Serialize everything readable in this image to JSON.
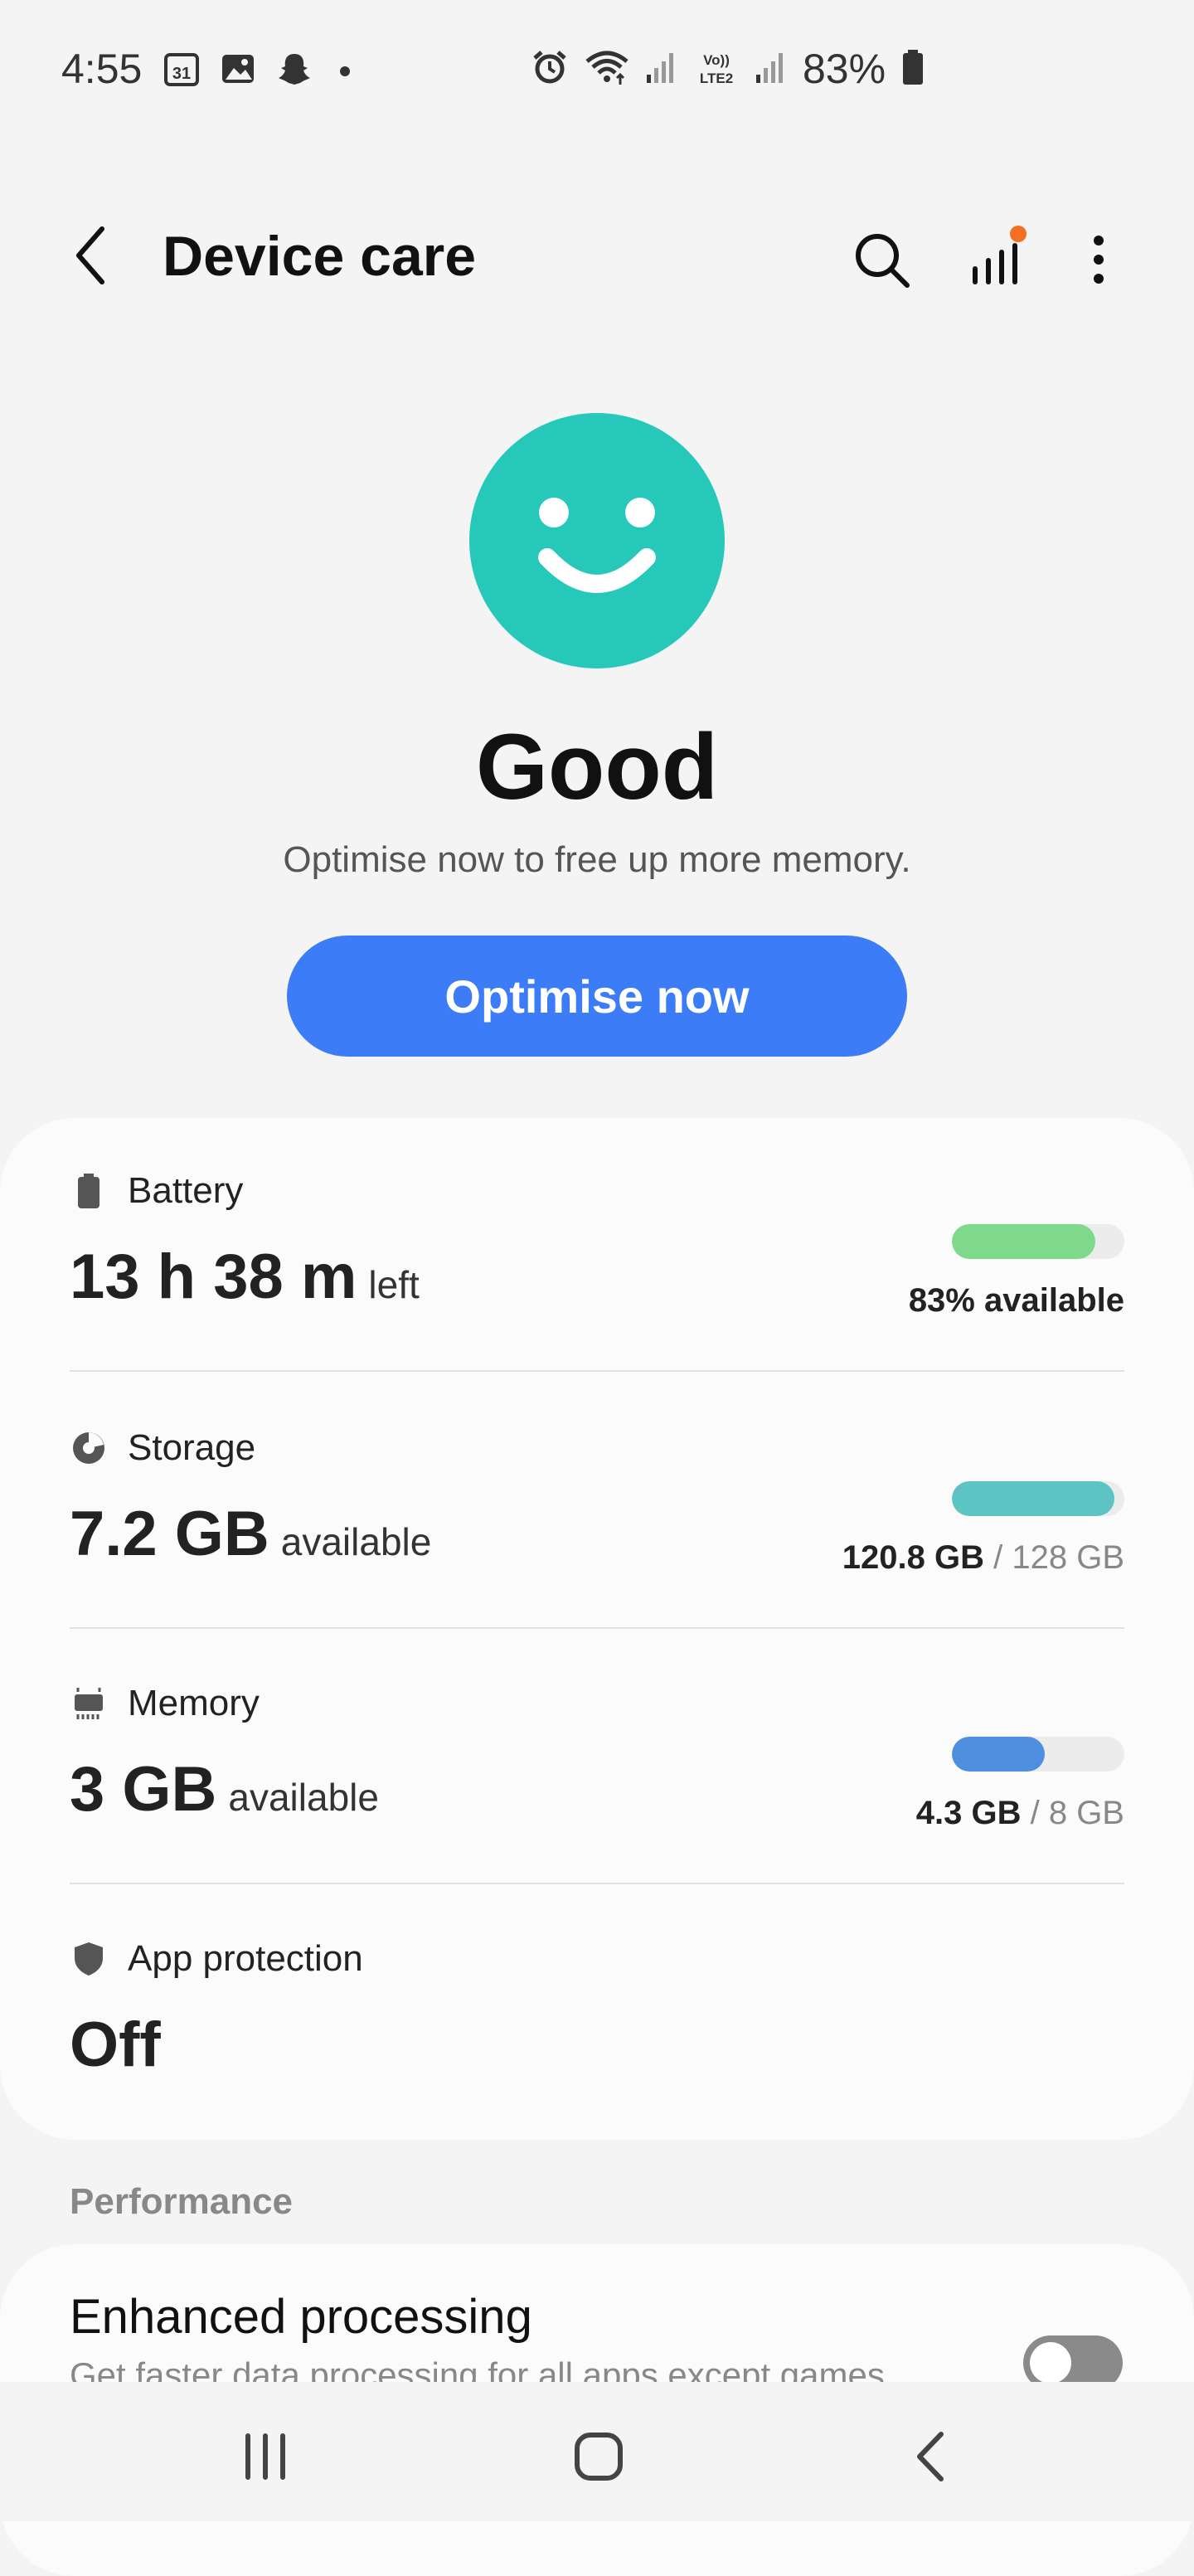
{
  "status_bar": {
    "time": "4:55",
    "battery_percent": "83%",
    "left_icons": [
      "calendar-icon",
      "gallery-icon",
      "snapchat-icon",
      "notification-dot-icon"
    ],
    "right_icons": [
      "alarm-icon",
      "wifi-icon",
      "signal-icon",
      "volte-icon",
      "signal-2-icon",
      "battery-icon"
    ]
  },
  "app_bar": {
    "title": "Device care",
    "icons": [
      "back-arrow-icon",
      "search-icon",
      "stats-icon",
      "more-vert-icon"
    ],
    "badge_color": "#f36f21"
  },
  "hero": {
    "status": "Good",
    "subtitle": "Optimise now to free up more memory.",
    "face_color": "#26c9b9",
    "button_label": "Optimise now",
    "button_color": "#3c7cf6"
  },
  "card": {
    "battery": {
      "label": "Battery",
      "value": "13 h 38 m",
      "unit": "left",
      "level": 0.83,
      "right_text": "83% available",
      "bar_color": "#7fd98a"
    },
    "storage": {
      "label": "Storage",
      "value": "7.2 GB",
      "unit": "available",
      "level": 0.94,
      "used": "120.8 GB",
      "total": "/ 128 GB",
      "bar_color": "#5cc4c2"
    },
    "memory": {
      "label": "Memory",
      "value": "3 GB",
      "unit": "available",
      "level": 0.54,
      "used": "4.3 GB",
      "total": "/ 8 GB",
      "bar_color": "#4f8fe0"
    },
    "app_protection": {
      "label": "App protection",
      "value": "Off"
    }
  },
  "performance": {
    "section_label": "Performance",
    "title": "Enhanced processing",
    "subtitle": "Get faster data processing for all apps except games",
    "toggle_on": false
  },
  "nav_bar": {
    "icons": [
      "recents-icon",
      "home-icon",
      "back-icon"
    ]
  }
}
